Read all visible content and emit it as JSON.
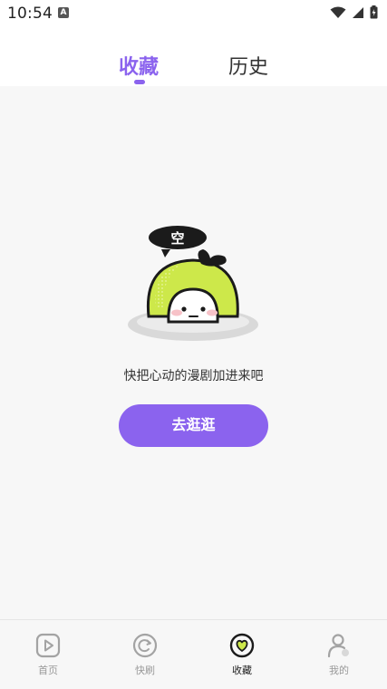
{
  "status_bar": {
    "time": "10:54",
    "a_badge": "A",
    "icons": [
      "wifi-icon",
      "signal-icon",
      "battery-icon"
    ]
  },
  "header": {
    "tabs": [
      {
        "label": "收藏",
        "active": true
      },
      {
        "label": "历史",
        "active": false
      }
    ]
  },
  "empty_state": {
    "bubble_text": "空",
    "message": "快把心动的漫剧加进来吧",
    "button_label": "去逛逛"
  },
  "bottom_nav": {
    "items": [
      {
        "label": "首页",
        "icon": "play-square-icon",
        "active": false
      },
      {
        "label": "快刷",
        "icon": "refresh-circle-icon",
        "active": false
      },
      {
        "label": "收藏",
        "icon": "heart-circle-icon",
        "active": true
      },
      {
        "label": "我的",
        "icon": "user-icon",
        "active": false
      }
    ]
  },
  "colors": {
    "accent": "#8b63ee",
    "mascot_green": "#cde84a",
    "background": "#f7f7f7"
  }
}
